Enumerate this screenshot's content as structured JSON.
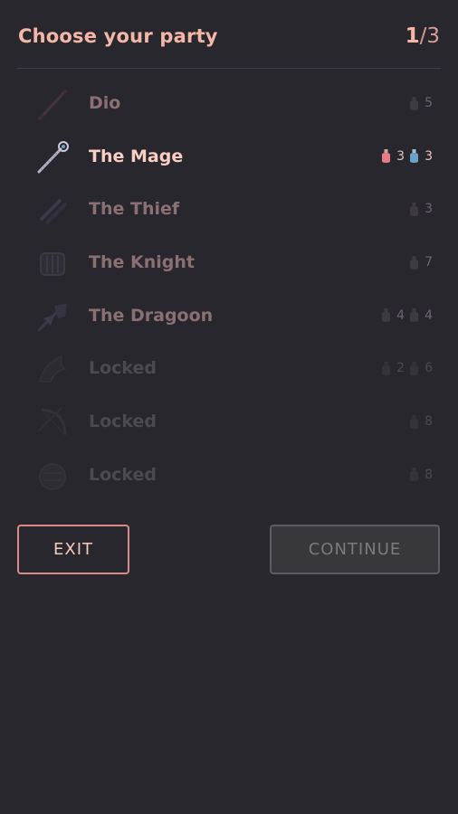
{
  "header": {
    "title": "Choose your party",
    "count_current": "1",
    "count_total": "/3"
  },
  "party": [
    {
      "name": "Dio",
      "icon": "baton-icon",
      "state": "dim",
      "red": "",
      "blue": "",
      "dark": "5"
    },
    {
      "name": "The Mage",
      "icon": "staff-icon",
      "state": "selected",
      "red": "3",
      "blue": "3",
      "dark": ""
    },
    {
      "name": "The Thief",
      "icon": "daggers-icon",
      "state": "dim",
      "red": "",
      "blue": "",
      "dark": "3"
    },
    {
      "name": "The Knight",
      "icon": "shield-icon",
      "state": "dim",
      "red": "",
      "blue": "",
      "dark": "7"
    },
    {
      "name": "The Dragoon",
      "icon": "lance-icon",
      "state": "dim",
      "red": "4",
      "blue": "4",
      "dark": ""
    },
    {
      "name": "Locked",
      "icon": "wing-icon",
      "state": "locked",
      "red": "2",
      "blue": "6",
      "dark": ""
    },
    {
      "name": "Locked",
      "icon": "bow-icon",
      "state": "locked",
      "red": "",
      "blue": "",
      "dark": "8"
    },
    {
      "name": "Locked",
      "icon": "orb-icon",
      "state": "locked",
      "red": "",
      "blue": "",
      "dark": "8"
    }
  ],
  "buttons": {
    "exit": "EXIT",
    "continue": "CONTINUE"
  },
  "colors": {
    "background": "#28272d",
    "accent": "#f4b7a7",
    "red_potion": "#e97a86",
    "blue_potion": "#6aa2c7"
  }
}
